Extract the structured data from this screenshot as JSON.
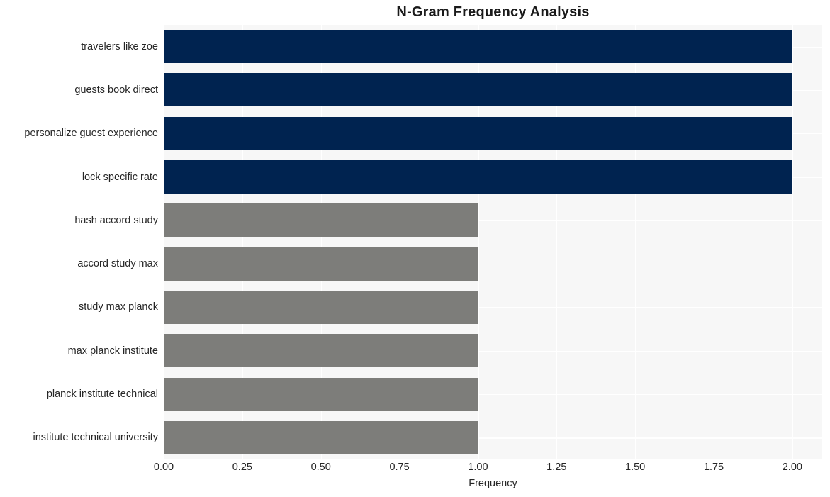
{
  "chart_data": {
    "type": "bar",
    "orientation": "horizontal",
    "title": "N-Gram Frequency Analysis",
    "xlabel": "Frequency",
    "ylabel": "",
    "xlim": [
      0,
      2.095
    ],
    "xticks": [
      0.0,
      0.25,
      0.5,
      0.75,
      1.0,
      1.25,
      1.5,
      1.75,
      2.0
    ],
    "xticklabels": [
      "0.00",
      "0.25",
      "0.50",
      "0.75",
      "1.00",
      "1.25",
      "1.50",
      "1.75",
      "2.00"
    ],
    "grid": true,
    "grid_color": "#ffffff",
    "plot_background": "#f7f7f7",
    "legend": null,
    "categories": [
      "travelers like zoe",
      "guests book direct",
      "personalize guest experience",
      "lock specific rate",
      "hash accord study",
      "accord study max",
      "study max planck",
      "max planck institute",
      "planck institute technical",
      "institute technical university"
    ],
    "values": [
      2,
      2,
      2,
      2,
      1,
      1,
      1,
      1,
      1,
      1
    ],
    "bar_colors": [
      "#002350",
      "#002350",
      "#002350",
      "#002350",
      "#7d7d7a",
      "#7d7d7a",
      "#7d7d7a",
      "#7d7d7a",
      "#7d7d7a",
      "#7d7d7a"
    ],
    "colors": {
      "highlight": "#002350",
      "default": "#7d7d7a",
      "text": "#262626",
      "title": "#1a1a1a"
    }
  }
}
